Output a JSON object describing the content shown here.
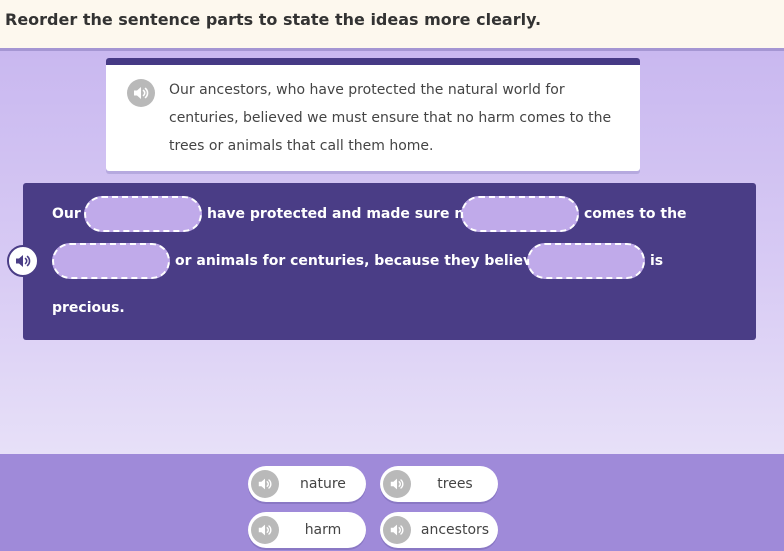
{
  "instruction": "Reorder the sentence parts to state the ideas more clearly.",
  "prompt": {
    "text": "Our ancestors, who have protected the natural world for centuries, believed we must ensure that no harm comes to the trees or animals that call them home.",
    "icon": "speaker-icon"
  },
  "sentence": {
    "part1": "Our",
    "part2": "have protected and made sure no",
    "part3": "comes to the",
    "part4": "or animals for centuries, because they believed",
    "part5": "is",
    "part6": "precious.",
    "blanks": [
      "",
      "",
      "",
      ""
    ]
  },
  "word_bank": [
    {
      "label": "nature"
    },
    {
      "label": "trees"
    },
    {
      "label": "harm"
    },
    {
      "label": "ancestors"
    }
  ],
  "colors": {
    "header_bg": "#fdf8ee",
    "panel_bg": "#4a3d86",
    "slot_bg": "#c0aaea",
    "bank_bg": "#9f8ad9"
  }
}
